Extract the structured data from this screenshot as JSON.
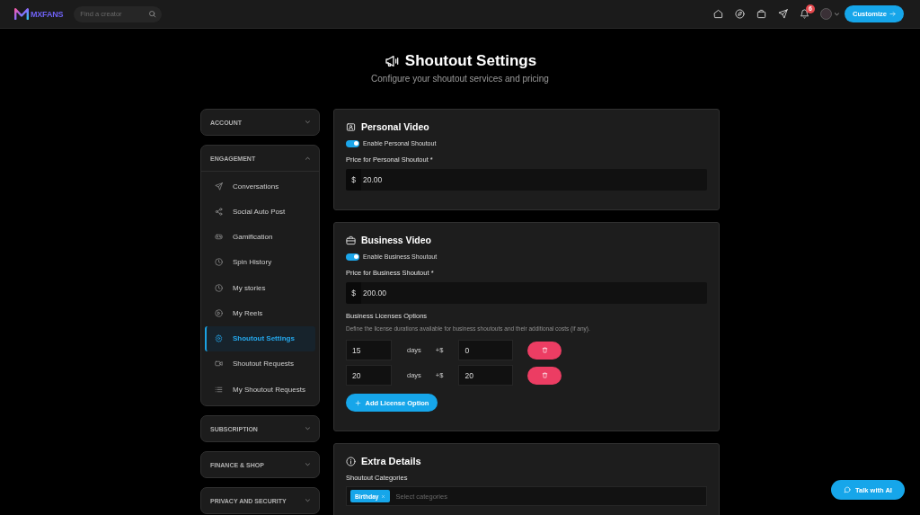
{
  "topbar": {
    "logo_text": "MXFANS",
    "search": {
      "placeholder": "Find a creator"
    },
    "notification_count": "6",
    "customize_button": "Customize"
  },
  "header": {
    "title": "Shoutout Settings",
    "subtitle": "Configure your shoutout services and pricing"
  },
  "sidebar": {
    "sections": [
      {
        "label": "ACCOUNT",
        "expanded": false
      },
      {
        "label": "ENGAGEMENT",
        "expanded": true,
        "items": [
          {
            "label": "Conversations",
            "selected": false
          },
          {
            "label": "Social Auto Post",
            "selected": false
          },
          {
            "label": "Gamification",
            "selected": false
          },
          {
            "label": "Spin History",
            "selected": false
          },
          {
            "label": "My stories",
            "selected": false
          },
          {
            "label": "My Reels",
            "selected": false
          },
          {
            "label": "Shoutout Settings",
            "selected": true
          },
          {
            "label": "Shoutout Requests",
            "selected": false
          },
          {
            "label": "My Shoutout Requests",
            "selected": false
          }
        ]
      },
      {
        "label": "SUBSCRIPTION",
        "expanded": false
      },
      {
        "label": "FINANCE & SHOP",
        "expanded": false
      },
      {
        "label": "PRIVACY AND SECURITY",
        "expanded": false
      }
    ]
  },
  "personal_video": {
    "title": "Personal Video",
    "toggle": {
      "label": "Enable Personal Shoutout",
      "on": true
    },
    "price": {
      "label": "Price for Personal Shoutout *",
      "currency": "$",
      "value": "20.00"
    }
  },
  "business_video": {
    "title": "Business Video",
    "toggle": {
      "label": "Enable Business Shoutout",
      "on": true
    },
    "price": {
      "label": "Price for Business Shoutout *",
      "currency": "$",
      "value": "200.00"
    },
    "licenses": {
      "title": "Business Licenses Options",
      "description": "Define the license durations available for business shoutouts and their additional costs (if any).",
      "options": [
        {
          "days": "15",
          "unit": "days",
          "extra_prefix": "+$",
          "extra": "0"
        },
        {
          "days": "20",
          "unit": "days",
          "extra_prefix": "+$",
          "extra": "20"
        }
      ],
      "add_button": "Add License Option"
    }
  },
  "extra_details": {
    "title": "Extra Details",
    "categories": {
      "label": "Shoutout Categories",
      "tags": [
        "Birthday"
      ],
      "placeholder": "Select categories"
    }
  },
  "chat_button": "Talk with AI"
}
